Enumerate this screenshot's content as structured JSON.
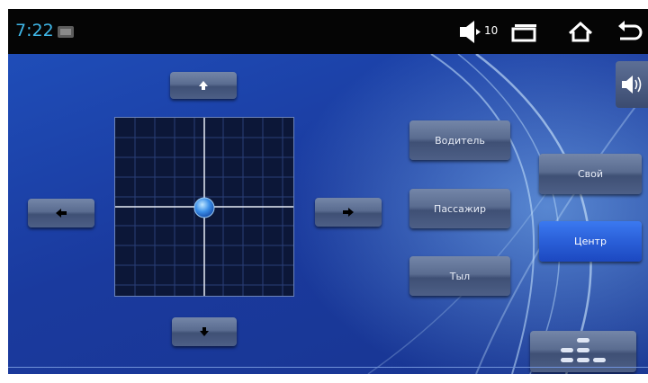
{
  "statusbar": {
    "time": "7:22",
    "volume_level": "10",
    "icons": [
      "photo-icon",
      "volume-icon",
      "recent-apps-icon",
      "home-icon",
      "back-icon"
    ]
  },
  "balance": {
    "up_icon": "arrow-up-icon",
    "down_icon": "arrow-down-icon",
    "left_icon": "arrow-left-icon",
    "right_icon": "arrow-right-icon"
  },
  "presets": {
    "driver_label": "Водитель",
    "passenger_label": "Пассажир",
    "rear_label": "Тыл",
    "custom_label": "Свой",
    "center_label": "Центр",
    "selected": "Центр"
  },
  "side": {
    "sound_icon": "speaker-sound-icon",
    "eq_icon": "equalizer-icon"
  },
  "colors": {
    "time": "#3fb7e8",
    "active_button": "#2a5fd8",
    "background": "#1c3f9e"
  }
}
